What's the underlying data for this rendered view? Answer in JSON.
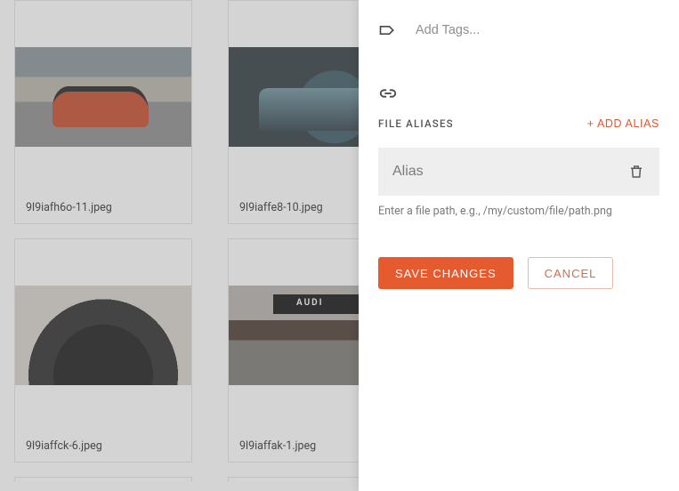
{
  "grid": {
    "cards": [
      {
        "filename": "9l9iafh6o-11.jpeg"
      },
      {
        "filename": "9l9iaffe8-10.jpeg"
      },
      {
        "filename": "9l9iaffck-6.jpeg"
      },
      {
        "filename": "9l9iaffak-1.jpeg"
      }
    ]
  },
  "panel": {
    "tags_placeholder": "Add Tags...",
    "section_label": "FILE ALIASES",
    "add_alias_label": "+ ADD ALIAS",
    "alias_placeholder": "Alias",
    "alias_hint": "Enter a file path, e.g., /my/custom/file/path.png",
    "save_label": "SAVE CHANGES",
    "cancel_label": "CANCEL"
  }
}
